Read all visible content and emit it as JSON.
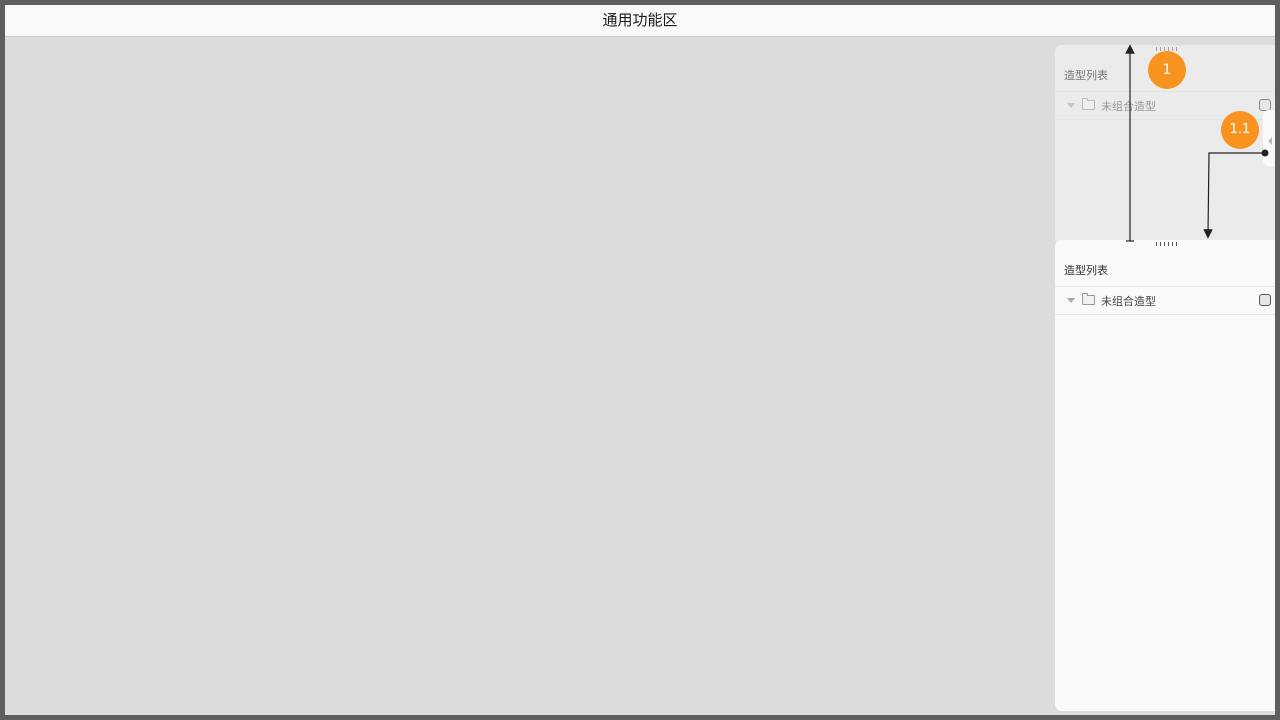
{
  "topbar": {
    "title": "通用功能区"
  },
  "ghost_panel": {
    "title": "造型列表",
    "row_label": "未组合造型"
  },
  "main_panel": {
    "title": "造型列表",
    "row_label": "未组合造型"
  },
  "annotations": {
    "badge_1": "1",
    "badge_2": "1.1",
    "badge_color": "#f7931e"
  },
  "icons": {
    "folder": "folder-icon",
    "caret": "caret-down-icon",
    "checkbox": "checkbox-icon",
    "grip": "drag-handle-icon"
  }
}
